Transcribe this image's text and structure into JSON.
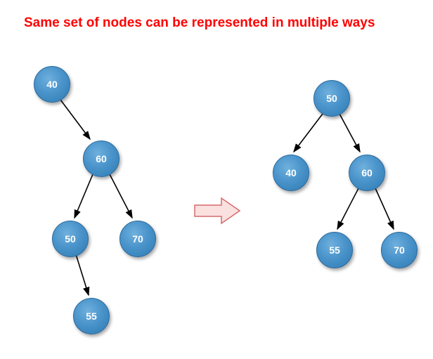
{
  "title": "Same set of nodes can be represented in multiple ways",
  "left_tree": {
    "root": "40",
    "n60": "60",
    "n50": "50",
    "n70": "70",
    "n55": "55"
  },
  "right_tree": {
    "root": "50",
    "n40": "40",
    "n60": "60",
    "n55": "55",
    "n70": "70"
  }
}
